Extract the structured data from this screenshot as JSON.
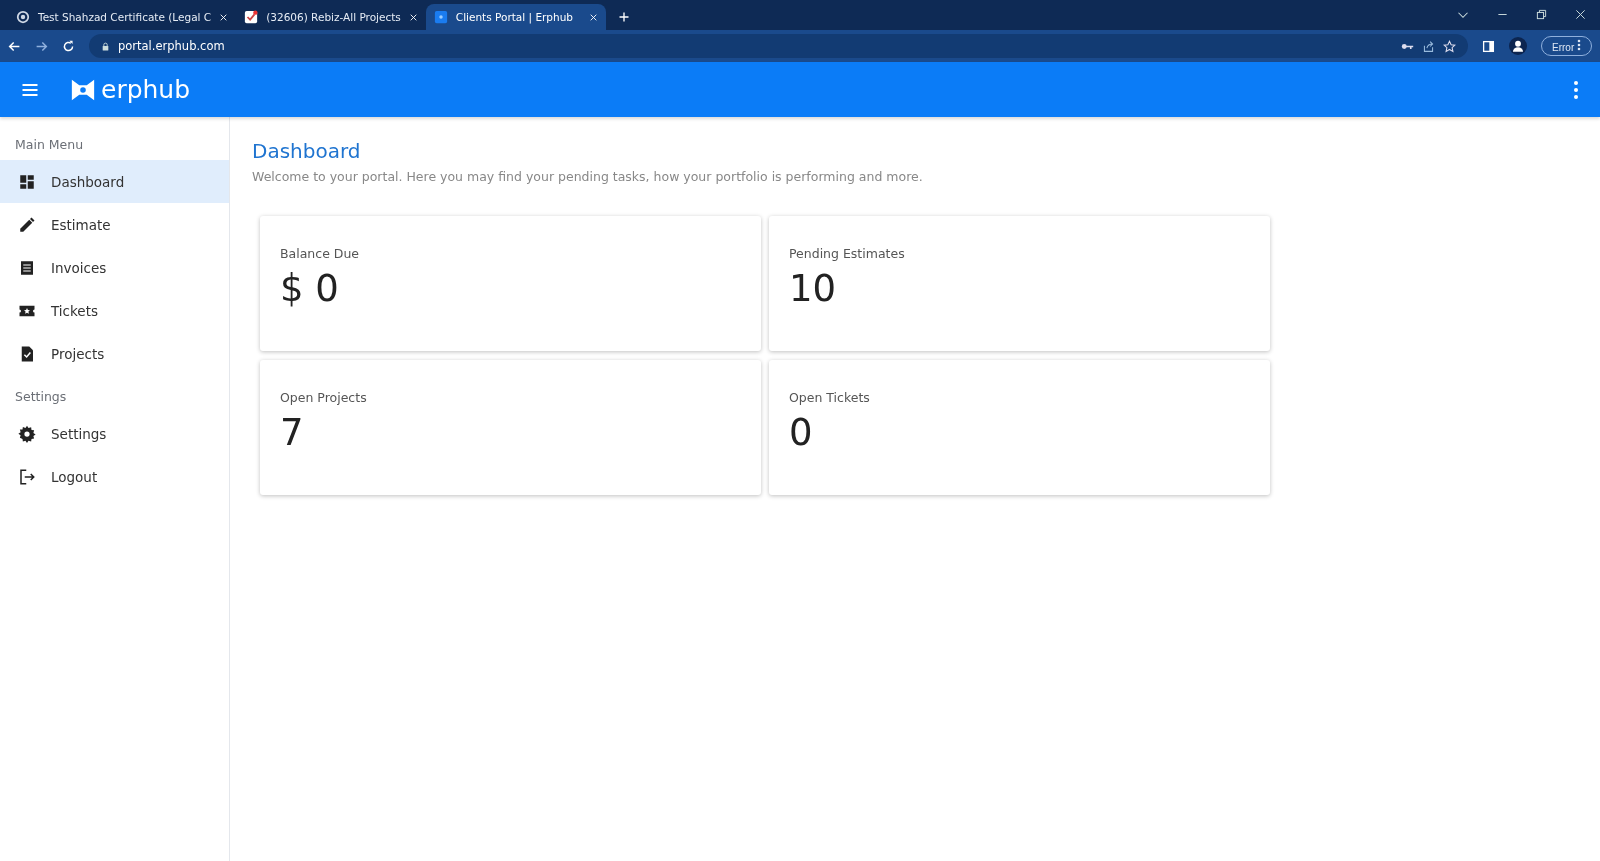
{
  "browser": {
    "tabs": [
      {
        "title": "Test Shahzad Certificate (Legal C",
        "kind": "rings",
        "selected": false
      },
      {
        "title": "(32606) Rebiz-All Projects",
        "kind": "check",
        "selected": false
      },
      {
        "title": "Clients Portal | Erphub",
        "kind": "erphub",
        "selected": true
      }
    ],
    "url": "portal.erphub.com",
    "profile_label": "Error"
  },
  "header": {
    "logo": "erphub"
  },
  "sidebar": {
    "sections": [
      {
        "heading": "Main Menu",
        "items": [
          {
            "label": "Dashboard",
            "kind": "dashboard",
            "selected": true
          },
          {
            "label": "Estimate",
            "kind": "pencil",
            "selected": false
          },
          {
            "label": "Invoices",
            "kind": "list",
            "selected": false
          },
          {
            "label": "Tickets",
            "kind": "ticket",
            "selected": false
          },
          {
            "label": "Projects",
            "kind": "doc-check",
            "selected": false
          }
        ]
      },
      {
        "heading": "Settings",
        "items": [
          {
            "label": "Settings",
            "kind": "gear",
            "selected": false
          },
          {
            "label": "Logout",
            "kind": "logout",
            "selected": false
          }
        ]
      }
    ]
  },
  "page": {
    "title": "Dashboard",
    "subtitle": "Welcome to your portal. Here you may find your pending tasks, how your portfolio is performing and more.",
    "cards": [
      {
        "label": "Balance Due",
        "value": "$ 0"
      },
      {
        "label": "Pending Estimates",
        "value": "10"
      },
      {
        "label": "Open Projects",
        "value": "7"
      },
      {
        "label": "Open Tickets",
        "value": "0"
      }
    ]
  }
}
